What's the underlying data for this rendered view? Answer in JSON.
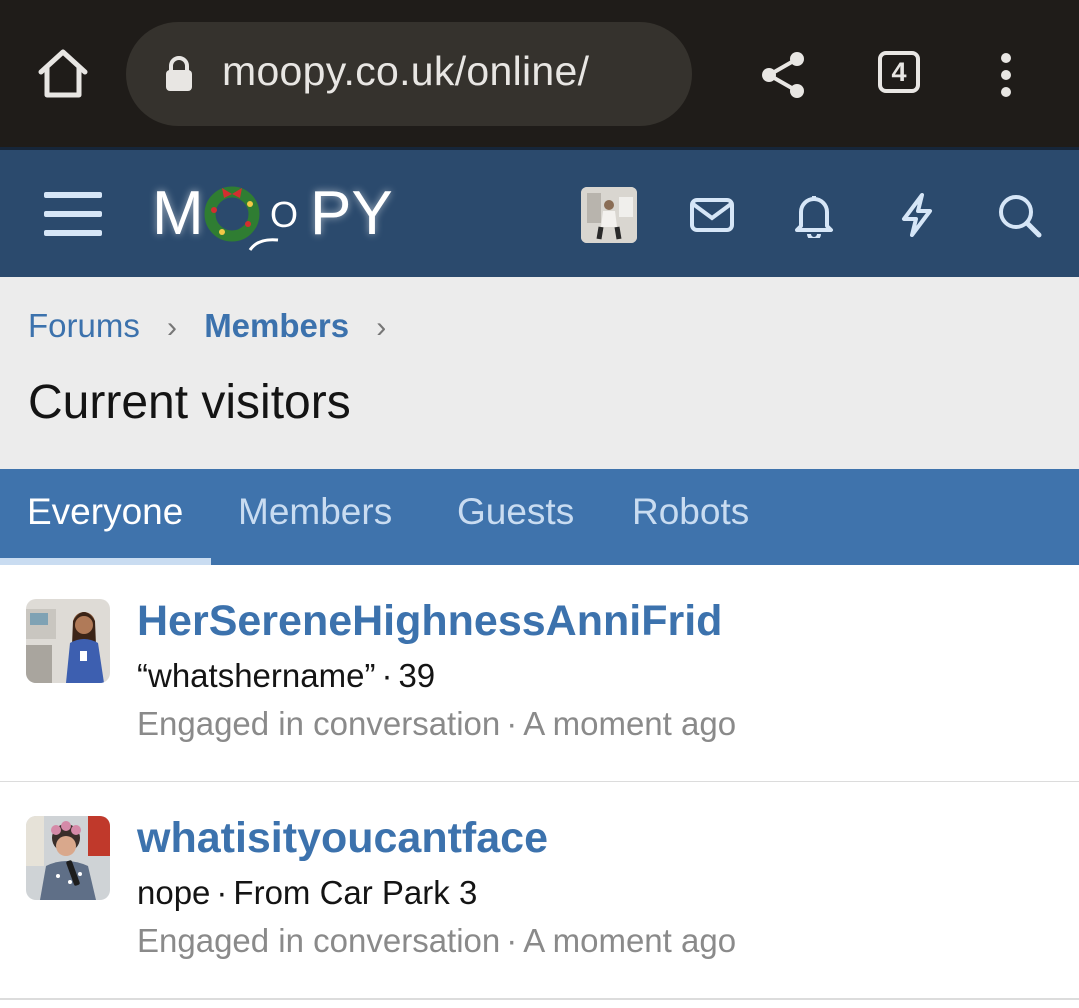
{
  "browser": {
    "url": "moopy.co.uk/online/",
    "tab_count": "4"
  },
  "site": {
    "logo_text_left": "M",
    "logo_text_right": "PY",
    "logo_small_o": "O"
  },
  "breadcrumb": {
    "items": [
      "Forums",
      "Members"
    ]
  },
  "page": {
    "title": "Current visitors"
  },
  "tabs": [
    {
      "label": "Everyone",
      "active": true
    },
    {
      "label": "Members",
      "active": false
    },
    {
      "label": "Guests",
      "active": false
    },
    {
      "label": "Robots",
      "active": false
    }
  ],
  "visitors": [
    {
      "username": "HerSereneHighnessAnniFrid",
      "title": "“whatshername”",
      "extra": "39",
      "activity": "Engaged in conversation",
      "time": "A moment ago"
    },
    {
      "username": "whatisityoucantface",
      "title": "nope",
      "extra": "From Car Park 3",
      "activity": "Engaged in conversation",
      "time": "A moment ago"
    }
  ],
  "colors": {
    "header_bg": "#2b4a6d",
    "tab_bg": "#3f73ac",
    "link": "#3c72ad"
  }
}
